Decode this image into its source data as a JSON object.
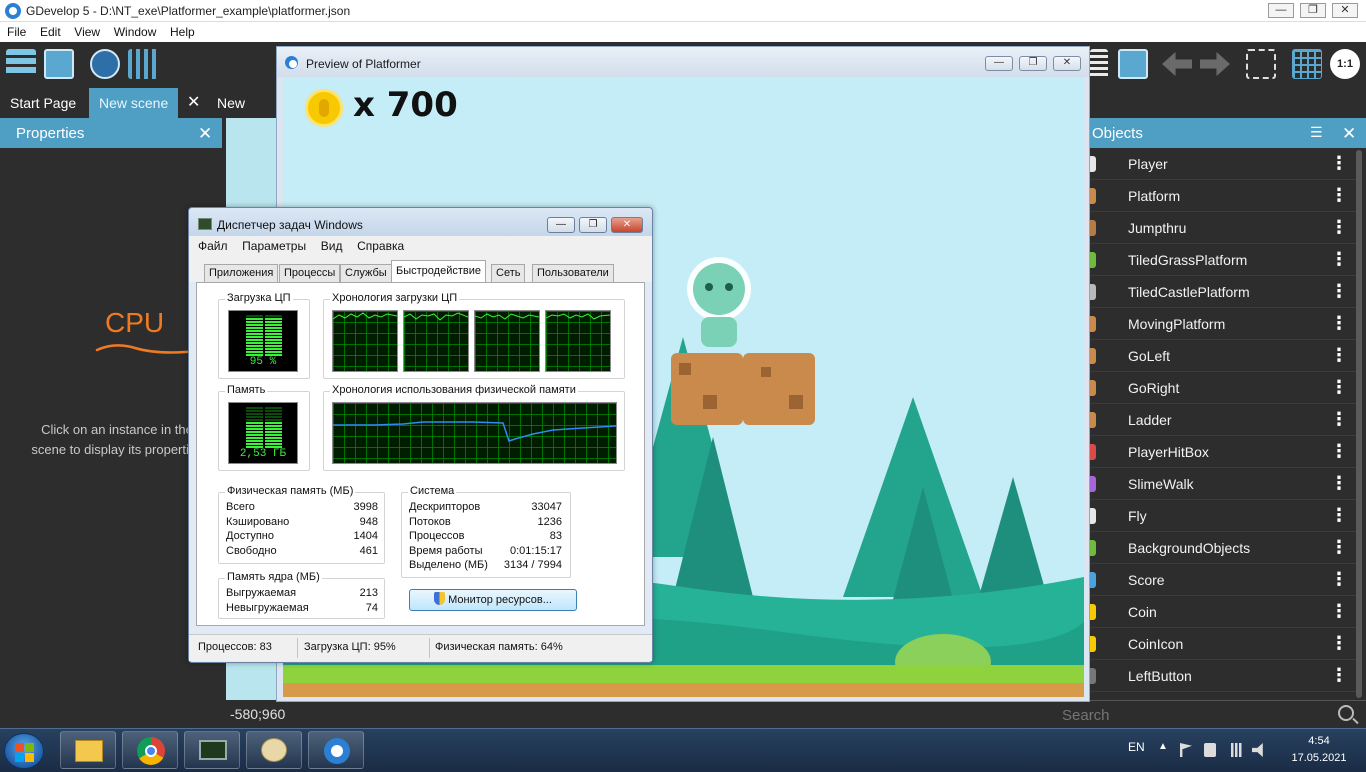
{
  "window": {
    "title": "GDevelop 5 - D:\\NT_exe\\Platformer_example\\platformer.json"
  },
  "menu": [
    "File",
    "Edit",
    "View",
    "Window",
    "Help"
  ],
  "tabs": [
    {
      "label": "Start Page"
    },
    {
      "label": "New scene"
    },
    {
      "label": "New scene"
    }
  ],
  "properties": {
    "title": "Properties",
    "hint_line1": "Click on an instance in the",
    "hint_line2": "scene to display its properties"
  },
  "objects": {
    "title": "Objects",
    "items": [
      {
        "name": "Player",
        "color": "#e8e8e8"
      },
      {
        "name": "Platform",
        "color": "#c98a4c"
      },
      {
        "name": "Jumpthru",
        "color": "#b87b43"
      },
      {
        "name": "TiledGrassPlatform",
        "color": "#6fbb3c"
      },
      {
        "name": "TiledCastlePlatform",
        "color": "#b9b9b9"
      },
      {
        "name": "MovingPlatform",
        "color": "#c98a4c"
      },
      {
        "name": "GoLeft",
        "color": "#c98a4c"
      },
      {
        "name": "GoRight",
        "color": "#c98a4c"
      },
      {
        "name": "Ladder",
        "color": "#c98a4c"
      },
      {
        "name": "PlayerHitBox",
        "color": "#d94b4b"
      },
      {
        "name": "SlimeWalk",
        "color": "#a766d8"
      },
      {
        "name": "Fly",
        "color": "#e8e8e8"
      },
      {
        "name": "BackgroundObjects",
        "color": "#6fbb3c"
      },
      {
        "name": "Score",
        "color": "#4aa3df"
      },
      {
        "name": "Coin",
        "color": "#f7c900"
      },
      {
        "name": "CoinIcon",
        "color": "#f7c900"
      },
      {
        "name": "LeftButton",
        "color": "#777777"
      }
    ]
  },
  "coords": "-580;960",
  "search": {
    "placeholder": "Search"
  },
  "preview": {
    "title": "Preview of Platformer",
    "coin_count": "x 700"
  },
  "annotation": {
    "label": "CPU",
    "color": "#f07a22"
  },
  "taskmgr": {
    "title": "Диспетчер задач Windows",
    "menu": [
      "Файл",
      "Параметры",
      "Вид",
      "Справка"
    ],
    "tabs": [
      "Приложения",
      "Процессы",
      "Службы",
      "Быстродействие",
      "Сеть",
      "Пользователи"
    ],
    "active_tab": "Быстродействие",
    "cpu_label": "Загрузка ЦП",
    "cpu_value": "95 %",
    "cpu_percent": 95,
    "cpu_history_label": "Хронология загрузки ЦП",
    "mem_label": "Память",
    "mem_value": "2,53 ГБ",
    "mem_percent": 64,
    "mem_history_label": "Хронология использования физической памяти",
    "phys": {
      "title": "Физическая память (МБ)",
      "rows": [
        {
          "label": "Всего",
          "value": "3998"
        },
        {
          "label": "Кэшировано",
          "value": "948"
        },
        {
          "label": "Доступно",
          "value": "1404"
        },
        {
          "label": "Свободно",
          "value": "461"
        }
      ]
    },
    "kernel": {
      "title": "Память ядра (МБ)",
      "rows": [
        {
          "label": "Выгружаемая",
          "value": "213"
        },
        {
          "label": "Невыгружаемая",
          "value": "74"
        }
      ]
    },
    "system": {
      "title": "Система",
      "rows": [
        {
          "label": "Дескрипторов",
          "value": "33047"
        },
        {
          "label": "Потоков",
          "value": "1236"
        },
        {
          "label": "Процессов",
          "value": "83"
        },
        {
          "label": "Время работы",
          "value": "0:01:15:17"
        },
        {
          "label": "Выделено (МБ)",
          "value": "3134 / 7994"
        }
      ]
    },
    "monitor_button": "Монитор ресурсов...",
    "status": {
      "processes": "Процессов: 83",
      "cpu": "Загрузка ЦП: 95%",
      "memory": "Физическая память: 64%"
    }
  },
  "tray": {
    "lang": "EN",
    "time": "4:54",
    "date": "17.05.2021"
  }
}
